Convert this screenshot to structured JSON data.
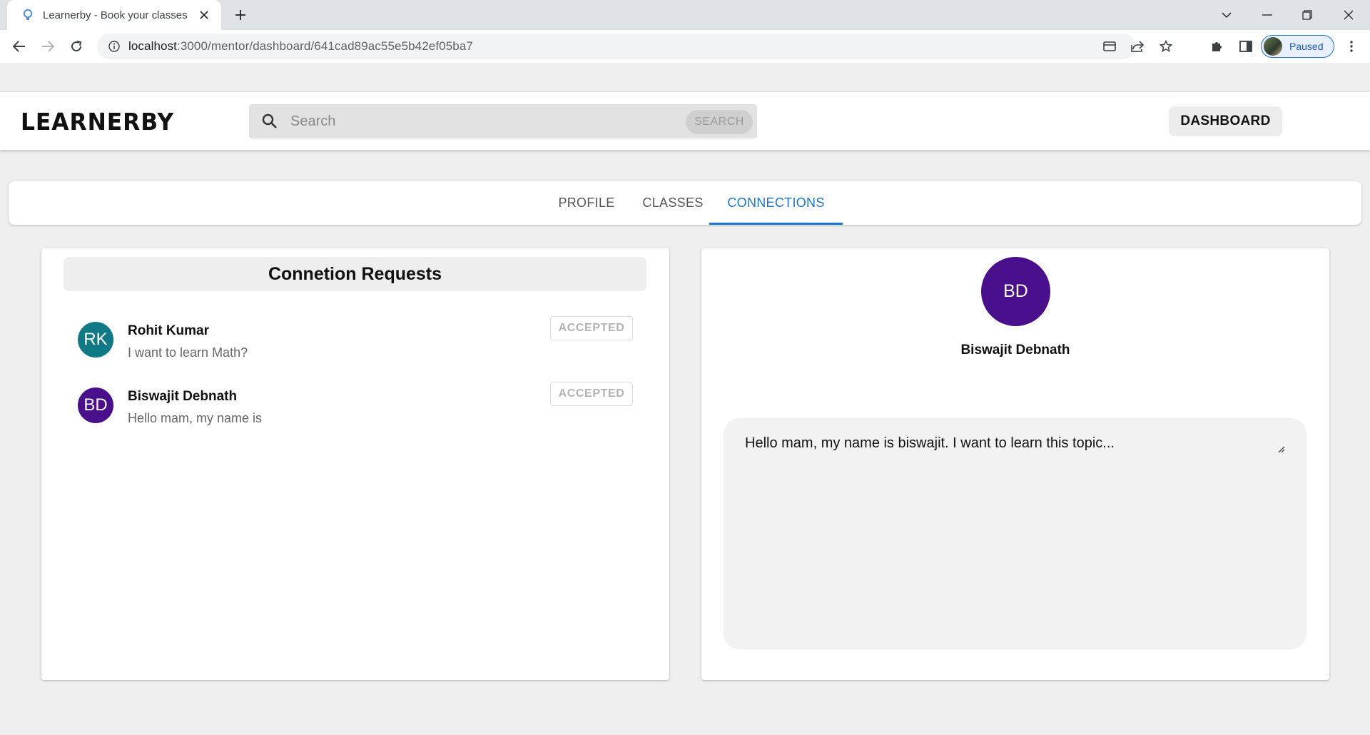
{
  "browser": {
    "tab_title": "Learnerby - Book your classes",
    "url_host": "localhost",
    "url_path": ":3000/mentor/dashboard/641cad89ac55e5b42ef05ba7",
    "profile_status": "Paused"
  },
  "header": {
    "logo": "LEARNERBY",
    "search_placeholder": "Search",
    "search_button": "SEARCH",
    "dashboard_button": "DASHBOARD"
  },
  "tabs": [
    {
      "label": "PROFILE",
      "active": false
    },
    {
      "label": "CLASSES",
      "active": false
    },
    {
      "label": "CONNECTIONS",
      "active": true
    }
  ],
  "requests_panel": {
    "title": "Connetion Requests",
    "items": [
      {
        "initials": "RK",
        "name": "Rohit Kumar",
        "message": "I want to learn Math?",
        "status": "ACCEPTED",
        "color": "#0f7a86"
      },
      {
        "initials": "BD",
        "name": "Biswajit Debnath",
        "message": "Hello mam, my name is",
        "status": "ACCEPTED",
        "color": "#4a0f8c"
      }
    ]
  },
  "detail_panel": {
    "initials": "BD",
    "name": "Biswajit Debnath",
    "message": "Hello mam, my name is biswajit. I want to learn this topic...",
    "avatar_color": "#4a0f8c"
  },
  "colors": {
    "accent": "#1976d2",
    "background": "#efefef"
  }
}
